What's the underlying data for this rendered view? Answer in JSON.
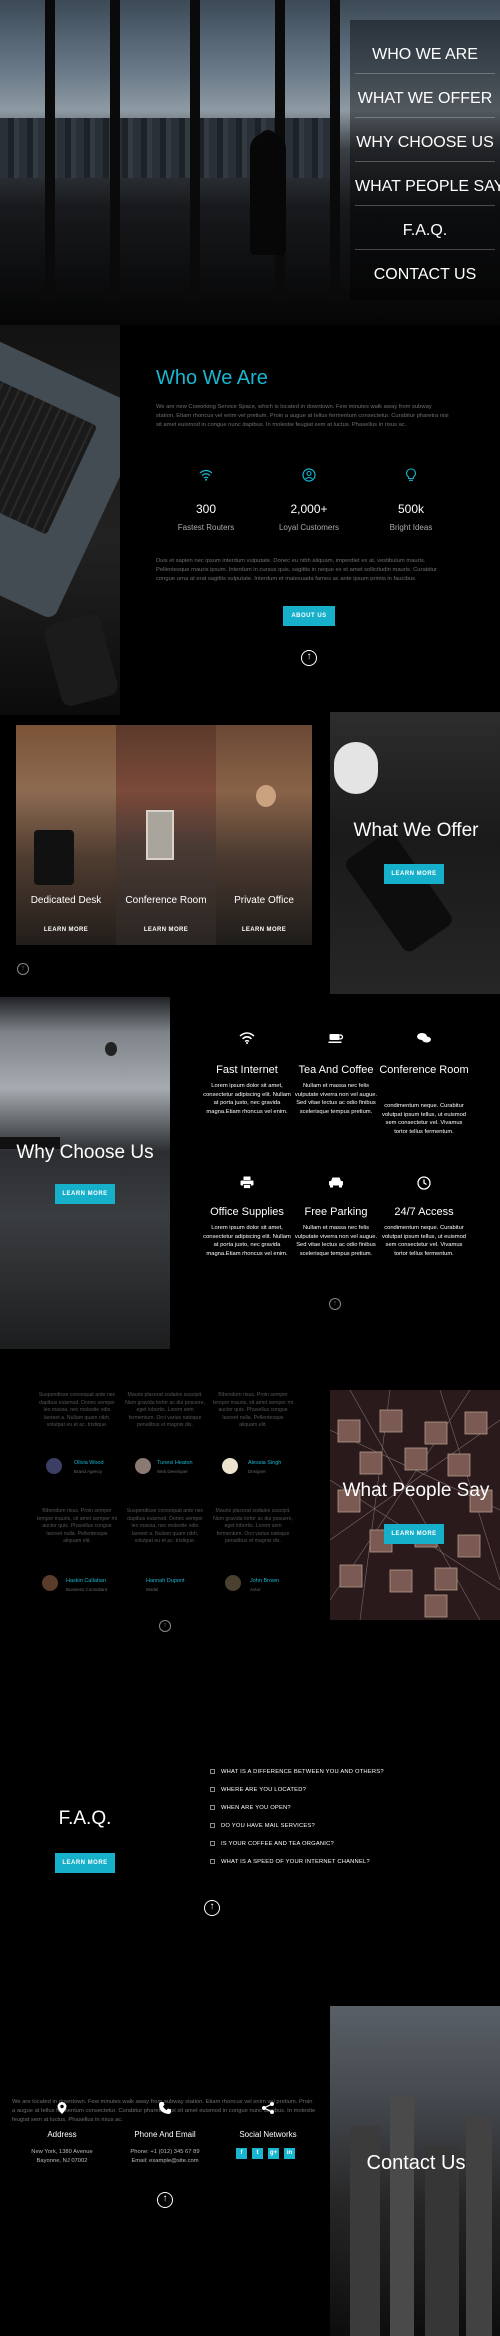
{
  "nav": {
    "items": [
      {
        "label": "WHO WE ARE"
      },
      {
        "label": "WHAT WE OFFER"
      },
      {
        "label": "WHY CHOOSE US"
      },
      {
        "label": "WHAT PEOPLE SAY"
      },
      {
        "label": "F.A.Q."
      },
      {
        "label": "CONTACT US"
      }
    ]
  },
  "who": {
    "title": "Who We Are",
    "intro": "We are new Coworking Service Space, which is located in downtown. Few minutes walk away from subway station. Etiam rhoncus vel enim vel pretium. Proin a augue at tellus fermentum consectetur. Curabitur pharetra nisi sit amet euismod in congue nunc dapibus. In molestie feugiat sem at luctus. Phasellus in risus ac.",
    "stats": [
      {
        "icon": "wifi-icon",
        "value": "300",
        "label": "Fastest Routers"
      },
      {
        "icon": "user-icon",
        "value": "2,000+",
        "label": "Loyal Customers"
      },
      {
        "icon": "lightbulb-icon",
        "value": "500k",
        "label": "Bright Ideas"
      }
    ],
    "body": "Duis et sapien nec ipsum interdum vulputate. Donec eu nibh aliquam, imperdiet ex at, vestibulum mauris. Pellentesque mauris ipsum. Interdum in cursus quis, sagittis in neque ex et amet sollicitudin mauris. Curabitur congue urna at erat sagittis vulputate. Interdum et malesuada fames ac ante ipsum primis in faucibus.",
    "button": "ABOUT US"
  },
  "offer": {
    "title": "What We Offer",
    "button": "LEARN MORE",
    "cards": [
      {
        "label": "Dedicated Desk",
        "link": "LEARN MORE"
      },
      {
        "label": "Conference Room",
        "link": "LEARN MORE"
      },
      {
        "label": "Private Office",
        "link": "LEARN MORE"
      }
    ]
  },
  "why": {
    "title": "Why Choose Us",
    "button": "LEARN MORE",
    "features": [
      {
        "icon": "wifi-icon",
        "title": "Fast Internet",
        "text": "Lorem ipsum dolor sit amet, consectetur adipiscing elit. Nullam at porta justo, nec gravida magna.Etiam rhoncus vel enim."
      },
      {
        "icon": "coffee-icon",
        "title": "Tea And Coffee",
        "text": "Nullam et massa nec felis vulputate viverra non vel augue. Sed vitae lectus ac odio finibus scelerisque tempus pretium."
      },
      {
        "icon": "chat-icon",
        "title": "Conference Room",
        "text": "condimentum neque. Curabitur volutpat ipsum tellus, ut euismod sem consectetur vel. Vivamus tortor tellus fermentum."
      },
      {
        "icon": "printer-icon",
        "title": "Office Supplies",
        "text": "Lorem ipsum dolor sit amet, consectetur adipiscing elit. Nullam at porta justo, nec gravida magna.Etiam rhoncus vel enim."
      },
      {
        "icon": "car-icon",
        "title": "Free Parking",
        "text": "Nullam et massa nec felis vulputate viverra non vel augue. Sed vitae lectus ac odio finibus scelerisque tempus pretium."
      },
      {
        "icon": "clock-icon",
        "title": "24/7 Access",
        "text": "condimentum neque. Curabitur volutpat ipsum tellus, ut euismod sem consectetur vel. Vivamus tortor tellus fermentum."
      }
    ]
  },
  "people": {
    "title": "What People Say",
    "button": "LEARN MORE",
    "testimonials": [
      {
        "text": "Suspendisse consequat ante nec dapibus euismod. Donec semper leo massa, nec molestie odio laoreet a. Nullam quam nibh, volutpat eu et ac. tristique.",
        "name": "Olivia Wood",
        "role": "Brand Agency",
        "avatar": "#3c3f63"
      },
      {
        "text": "Mauris placerat sodales suscipit. Nam gravida tortor ac dui posuere, eget lobortis. Lorem sem fermentum. Orci varius natoque penatibus et magnis dis.",
        "name": "Tunesi Heaton",
        "role": "Web Developer",
        "avatar": "#8a7a72"
      },
      {
        "text": "Bibendum risus. Proin semper tempor mauris, sit amet semper mi auctor quis. Phasellus congue laoreet nulla. Pellentesque aliquam elit.",
        "name": "Alessia Singh",
        "role": "Designer",
        "avatar": "#ece3cf"
      },
      {
        "text": "Bibendum risus. Proin semper tempor mauris, sit amet semper mi auctor quis. Phasellus congue laoreet nulla. Pellentesque aliquam elit.",
        "name": "Haskin Callahan",
        "role": "Business Consultant",
        "avatar": "#5a3c2a"
      },
      {
        "text": "Suspendisse consequat ante nec dapibus euismod. Donec semper leo massa, nec molestie odio laoreet a. Nullam quam nibh, volutpat eu et ac. tristique.",
        "name": "Hannah Dupont",
        "role": "Model",
        "avatar": "#000000"
      },
      {
        "text": "Mauris placerat sodales suscipit. Nam gravida tortor ac dui posuere, eget lobortis. Lorem sem fermentum. Orci varius natoque penatibus et magnis dis.",
        "name": "John Brown",
        "role": "Actor",
        "avatar": "#4a4030"
      }
    ]
  },
  "faq": {
    "title": "F.A.Q.",
    "button": "LEARN MORE",
    "items": [
      {
        "q": "WHAT IS A DIFFERENCE BETWEEN YOU AND OTHERS?"
      },
      {
        "q": "WHERE ARE YOU LOCATED?"
      },
      {
        "q": "WHEN ARE YOU OPEN?"
      },
      {
        "q": "DO YOU HAVE MAIL SERVICES?"
      },
      {
        "q": "IS YOUR COFFEE AND TEA ORGANIC?"
      },
      {
        "q": "WHAT IS A SPEED OF YOUR INTERNET CHANNEL?"
      }
    ]
  },
  "contact": {
    "title": "Contact Us",
    "intro": "We are located in downtown. Few minutes walk away from subway station. Etiam rhoncus vel enim vel pretium. Proin a augue at tellus fermentum consectetur. Curabitur pharetra nisi sit amet euismod in congue nunc dapibus. In molestie feugiat sem at luctus. Phasellus in risus ac.",
    "blocks": [
      {
        "icon": "location-icon",
        "title": "Address",
        "line1": "New York, 1380 Avenue",
        "line2": "Bayonne, NJ 07002"
      },
      {
        "icon": "phone-icon",
        "title": "Phone And Email",
        "line1": "Phone: +1 (012) 345 67 89",
        "line2": "Email: example@site.com"
      },
      {
        "icon": "share-icon",
        "title": "Social Networks"
      }
    ],
    "social": [
      {
        "icon": "facebook-icon",
        "glyph": "f"
      },
      {
        "icon": "twitter-icon",
        "glyph": "t"
      },
      {
        "icon": "googleplus-icon",
        "glyph": "g+"
      },
      {
        "icon": "linkedin-icon",
        "glyph": "in"
      }
    ]
  },
  "colors": {
    "accent": "#18b6d0",
    "background": "#000000",
    "text": "#ffffff"
  }
}
